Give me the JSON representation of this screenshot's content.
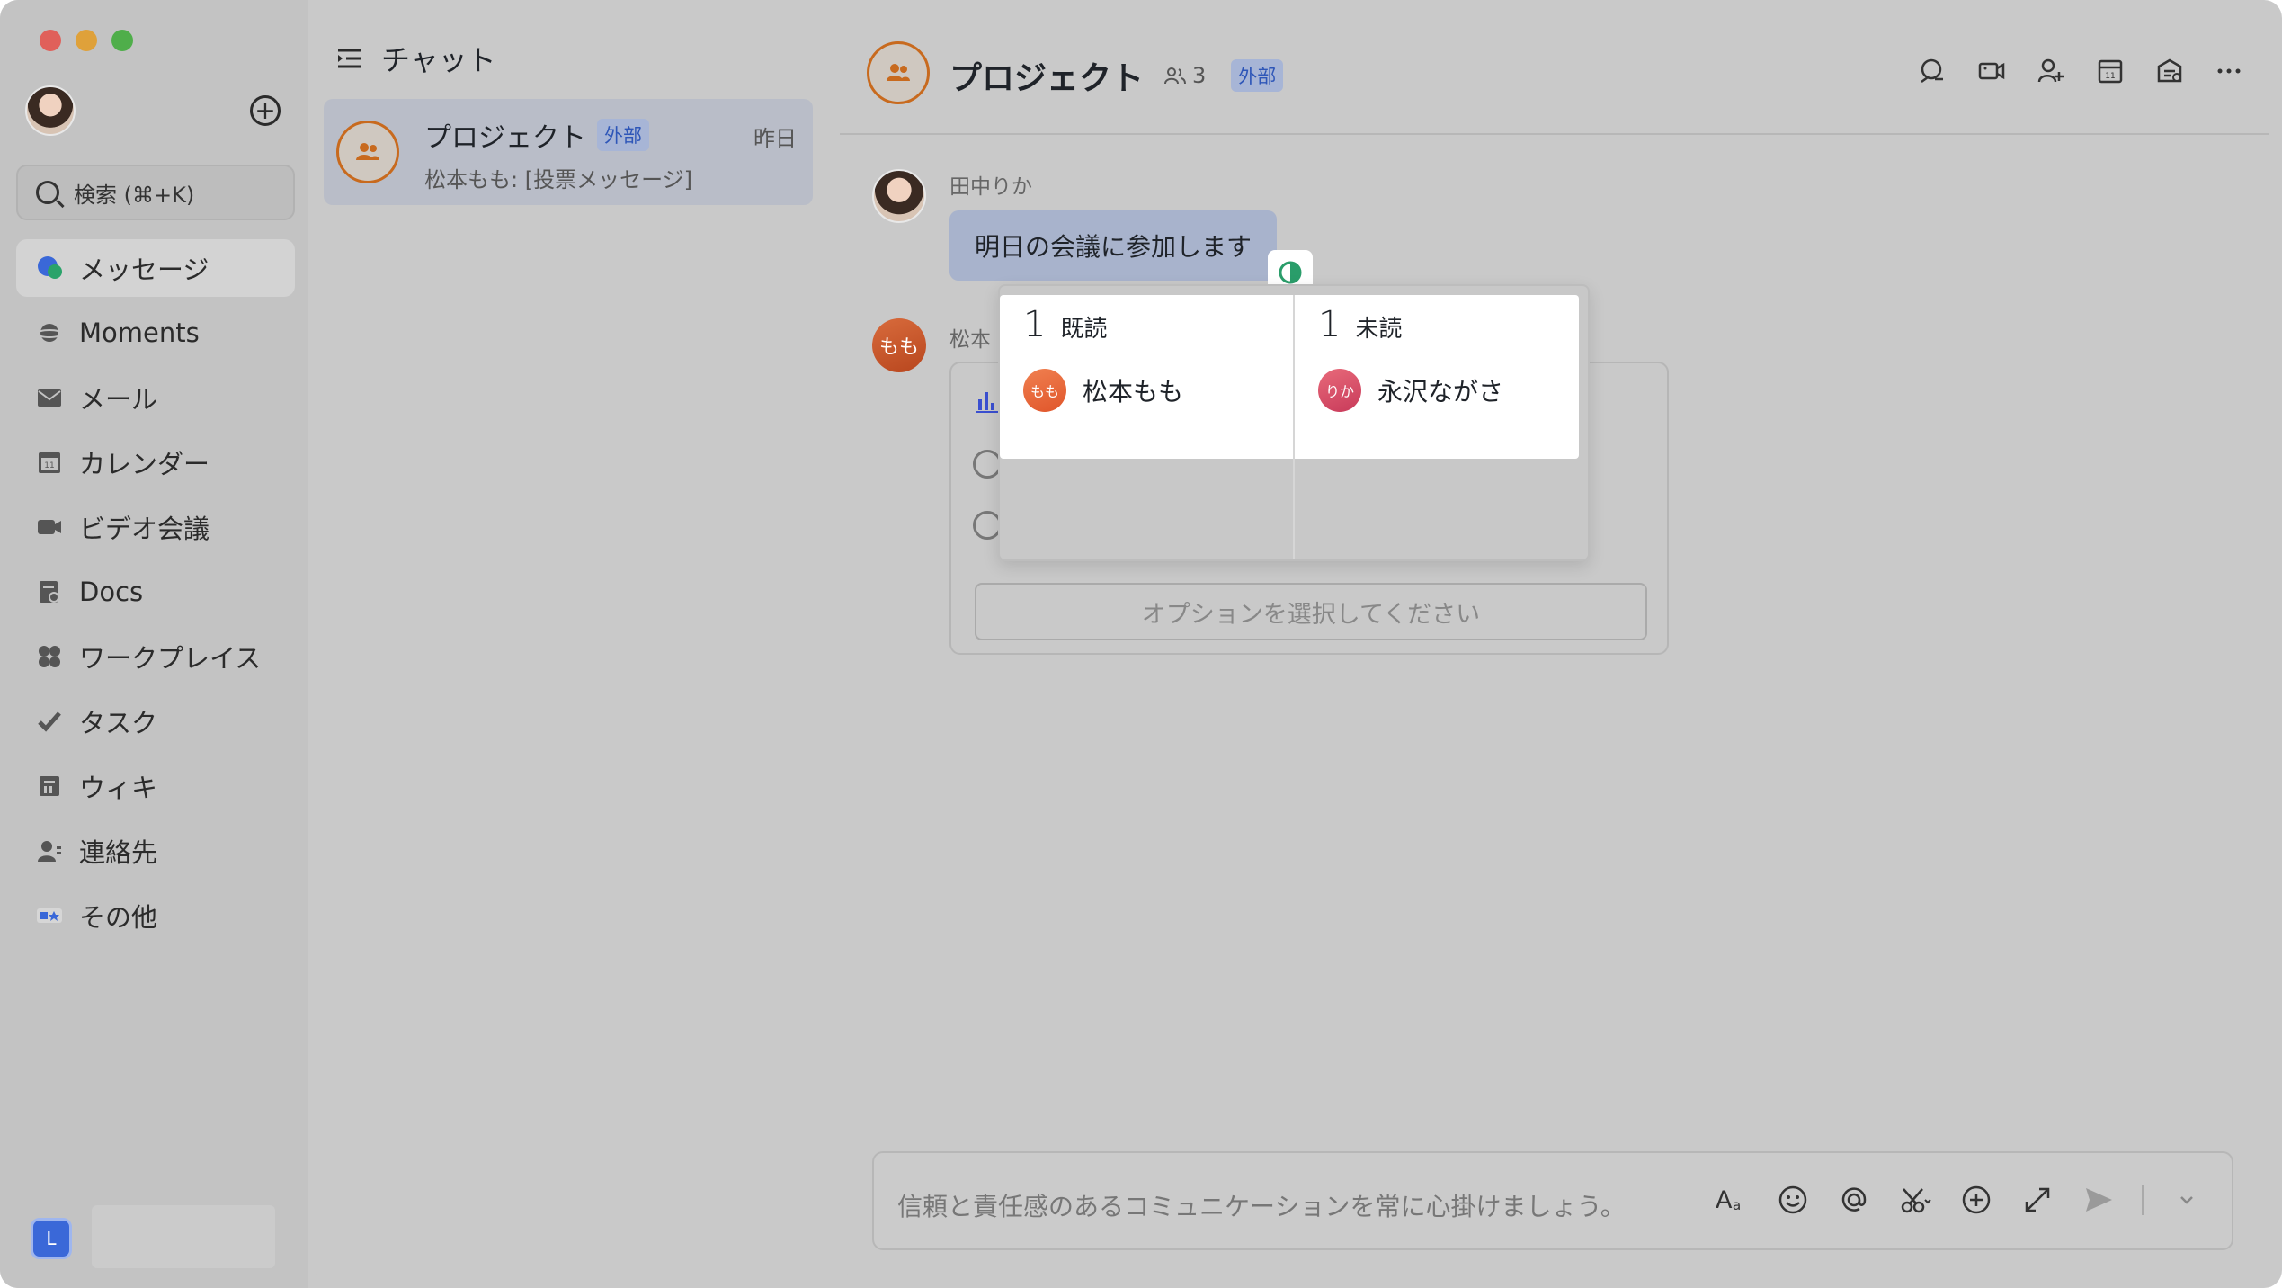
{
  "sidebar": {
    "search_placeholder": "検索 (⌘+K)",
    "items": [
      {
        "label": "メッセージ"
      },
      {
        "label": "Moments"
      },
      {
        "label": "メール"
      },
      {
        "label": "カレンダー"
      },
      {
        "label": "ビデオ会議"
      },
      {
        "label": "Docs"
      },
      {
        "label": "ワークプレイス"
      },
      {
        "label": "タスク"
      },
      {
        "label": "ウィキ"
      },
      {
        "label": "連絡先"
      },
      {
        "label": "その他"
      }
    ],
    "bottom_badge": "L"
  },
  "chatlist": {
    "title": "チャット",
    "items": [
      {
        "name": "プロジェクト",
        "badge": "外部",
        "time": "昨日",
        "preview": "松本もも: [投票メッセージ]"
      }
    ]
  },
  "chat": {
    "title": "プロジェクト",
    "member_count": "3",
    "badge": "外部",
    "messages": [
      {
        "sender": "田中りか",
        "text": "明日の会議に参加します"
      },
      {
        "sender": "松本",
        "avatar_text": "もも"
      }
    ],
    "vote": {
      "select_placeholder": "オプションを選択してください"
    },
    "input_placeholder": "信頼と責任感のあるコミュニケーションを常に心掛けましょう。"
  },
  "read_receipt": {
    "read": {
      "count": "1",
      "label": "既読",
      "people": [
        {
          "name": "松本もも",
          "avatar_text": "もも"
        }
      ]
    },
    "unread": {
      "count": "1",
      "label": "未読",
      "people": [
        {
          "name": "永沢ながさ",
          "avatar_text": "りか"
        }
      ]
    }
  },
  "colors": {
    "accent_blue": "#3a68d8",
    "group_orange": "#c86a1e",
    "badge_bg": "#a7b5d6",
    "read_green": "#2a9d6a"
  }
}
